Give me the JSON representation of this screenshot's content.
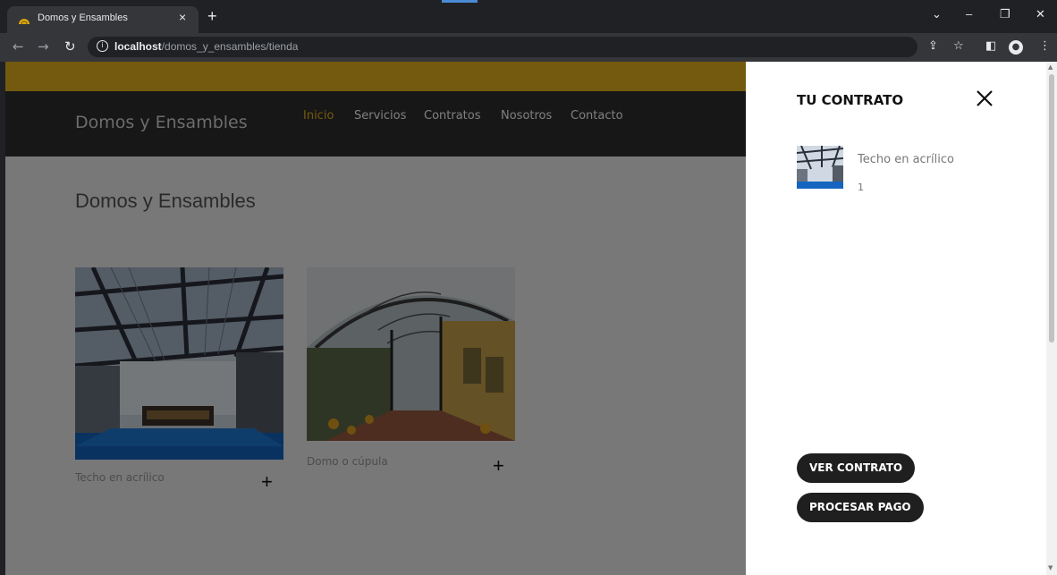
{
  "browser": {
    "tab_title": "Domos y Ensambles",
    "tab_close": "×",
    "new_tab": "+",
    "url_host": "localhost",
    "url_path": "/domos_y_ensambles/tienda",
    "icons": [
      "back-icon",
      "forward-icon",
      "reload-icon",
      "info-icon",
      "share-icon",
      "star-icon",
      "sidepanel-icon",
      "profile-icon",
      "menu-icon"
    ]
  },
  "site": {
    "brand": "Domos y Ensambles",
    "menu": [
      {
        "label": "Inicio",
        "active": true
      },
      {
        "label": "Servicios",
        "active": false
      },
      {
        "label": "Contratos",
        "active": false
      },
      {
        "label": "Nosotros",
        "active": false
      },
      {
        "label": "Contacto",
        "active": false
      }
    ],
    "content_title": "Domos y Ensambles",
    "products": [
      {
        "name": "Techo en acrílico",
        "add": "+"
      },
      {
        "name": "Domo o cúpula",
        "add": "+"
      }
    ],
    "colors": {
      "accent": "#e8b51c",
      "header": "#2e2e2e"
    }
  },
  "panel": {
    "title": "TU CONTRATO",
    "item": {
      "name": "Techo en acrílico",
      "qty": "1"
    },
    "btn_view": "VER CONTRATO",
    "btn_pay": "PROCESAR PAGO"
  }
}
